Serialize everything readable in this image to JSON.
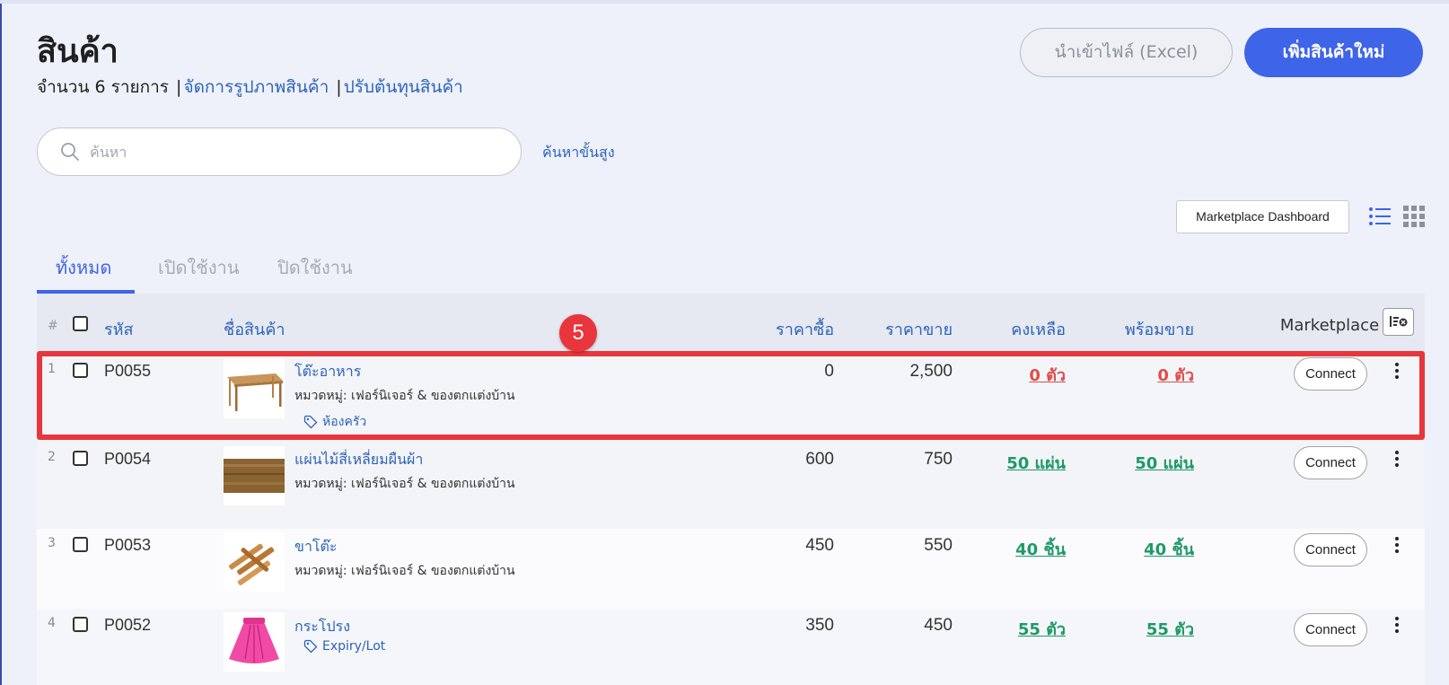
{
  "header": {
    "title": "สินค้า",
    "count_text": "จำนวน 6 รายการ",
    "separator": "|",
    "manage_images_link": "จัดการรูปภาพสินค้า",
    "adjust_cost_link": "ปรับต้นทุนสินค้า",
    "import_button": "นำเข้าไฟล์ (Excel)",
    "add_button": "เพิ่มสินค้าใหม่"
  },
  "search": {
    "placeholder": "ค้นหา",
    "value": "",
    "advanced_link": "ค้นหาขั้นสูง"
  },
  "toolbar": {
    "marketplace_dashboard": "Marketplace Dashboard",
    "list_view_icon": "list-view-icon",
    "grid_view_icon": "grid-view-icon"
  },
  "tabs": [
    {
      "label": "ทั้งหมด",
      "active": true
    },
    {
      "label": "เปิดใช้งาน",
      "active": false
    },
    {
      "label": "ปิดใช้งาน",
      "active": false
    }
  ],
  "table": {
    "columns": {
      "hash": "#",
      "code": "รหัส",
      "name": "ชื่อสินค้า",
      "buy_price": "ราคาซื้อ",
      "sell_price": "ราคาขาย",
      "remaining": "คงเหลือ",
      "ready": "พร้อมขาย",
      "marketplace": "Marketplace"
    },
    "rows": [
      {
        "index": "1",
        "code": "P0055",
        "name": "โต๊ะอาหาร",
        "category": "หมวดหมู่: เฟอร์นิเจอร์ & ของตกแต่งบ้าน",
        "tag": "ห้องครัว",
        "buy_price": "0",
        "sell_price": "2,500",
        "remaining": "0 ตัว",
        "ready": "0 ตัว",
        "stock_status": "out",
        "connect": "Connect"
      },
      {
        "index": "2",
        "code": "P0054",
        "name": "แผ่นไม้สี่เหลี่ยมผืนผ้า",
        "category": "หมวดหมู่: เฟอร์นิเจอร์ & ของตกแต่งบ้าน",
        "tag": "",
        "buy_price": "600",
        "sell_price": "750",
        "remaining": "50 แผ่น",
        "ready": "50 แผ่น",
        "stock_status": "in",
        "connect": "Connect"
      },
      {
        "index": "3",
        "code": "P0053",
        "name": "ขาโต๊ะ",
        "category": "หมวดหมู่: เฟอร์นิเจอร์ & ของตกแต่งบ้าน",
        "tag": "",
        "buy_price": "450",
        "sell_price": "550",
        "remaining": "40 ชิ้น",
        "ready": "40 ชิ้น",
        "stock_status": "in",
        "connect": "Connect"
      },
      {
        "index": "4",
        "code": "P0052",
        "name": "กระโปรง",
        "category": "",
        "tag": "Expiry/Lot",
        "buy_price": "350",
        "sell_price": "450",
        "remaining": "55 ตัว",
        "ready": "55 ตัว",
        "stock_status": "in",
        "connect": "Connect"
      }
    ]
  },
  "annotation": {
    "step_number": "5"
  },
  "colors": {
    "accent": "#3e64e8",
    "link": "#2d63b8",
    "out_of_stock": "#e04d4d",
    "in_stock": "#1f9a68",
    "highlight": "#e8363c"
  }
}
